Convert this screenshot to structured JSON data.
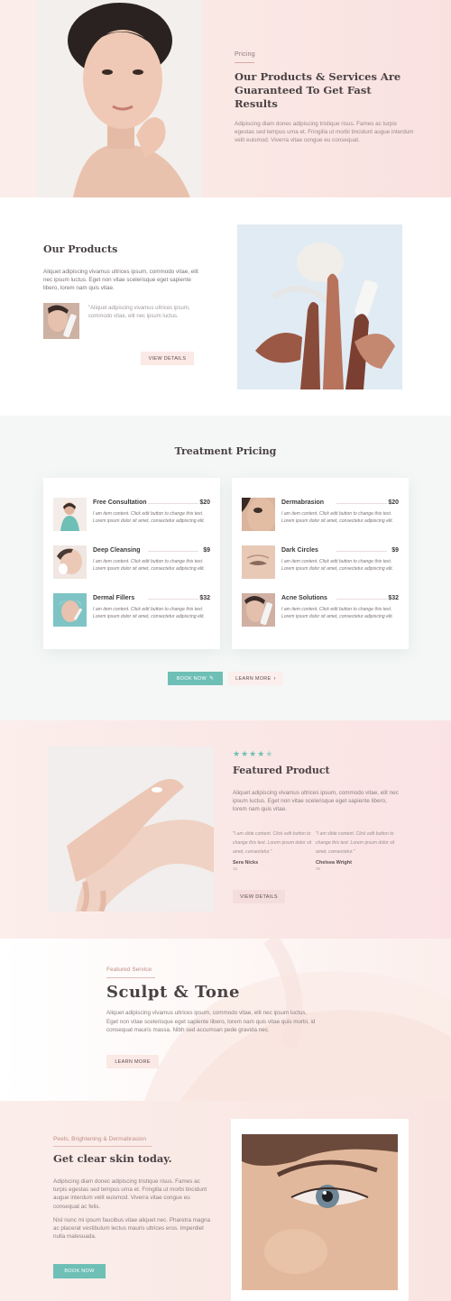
{
  "hero": {
    "eyebrow": "Pricing",
    "title": "Our Products & Services Are Guaranteed To Get Fast Results",
    "body": "Adipiscing diam donec adipiscing tristique risus. Fames ac turpis egestas sed tempus urna et. Fringilla ut morbi tincidunt augue interdum velit euismod. Viverra vitae congue eu consequat."
  },
  "products": {
    "title": "Our Products",
    "body": "Aliquet adipiscing vivamus ultrices ipsum, commodo vitae, elit nec ipsum luctus. Eget non vitae scelerisque eget sapiente libero, lorem nam quis vitae.",
    "quote": "\"Aliquet adipiscing vivamus ultrices ipsum, commodo vitae, elit nec ipsum luctus.",
    "button": "VIEW DETAILS"
  },
  "pricing": {
    "title": "Treatment Pricing",
    "left": [
      {
        "name": "Free Consultation",
        "price": "$20",
        "desc": "I am item content. Click edit button to change this text. Lorem ipsum dolor sit amet, consectetur adipiscing elit."
      },
      {
        "name": "Deep Cleansing",
        "price": "$9",
        "desc": "I am item content. Click edit button to change this text. Lorem ipsum dolor sit amet, consectetur adipiscing elit."
      },
      {
        "name": "Dermal Fillers",
        "price": "$32",
        "desc": "I am item content. Click edit button to change this text. Lorem ipsum dolor sit amet, consectetur adipiscing elit."
      }
    ],
    "right": [
      {
        "name": "Dermabrasion",
        "price": "$20",
        "desc": "I am item content. Click edit button to change this text. Lorem ipsum dolor sit amet, consectetur adipiscing elit."
      },
      {
        "name": "Dark Circles",
        "price": "$9",
        "desc": "I am item content. Click edit button to change this text. Lorem ipsum dolor sit amet, consectetur adipiscing elit."
      },
      {
        "name": "Acne Solutions",
        "price": "$32",
        "desc": "I am item content. Click edit button to change this text. Lorem ipsum dolor sit amet, consectetur adipiscing elit."
      }
    ],
    "book_button": "BOOK NOW",
    "learn_button": "LEARN MORE"
  },
  "featured": {
    "rating": 4.5,
    "title": "Featured Product",
    "body": "Aliquet adipiscing vivamus ultrices ipsum, commodo vitae, elit nec ipsum luctus. Eget non vitae scelerisque eget sapiente libero, lorem nam quis vitae.",
    "testimonials": [
      {
        "quote": "\"I am slide content. Click edit button to change this text. Lorem ipsum dolor sit amet, consectetur.\"",
        "name": "Sera Nicks",
        "role": "15"
      },
      {
        "quote": "\"I am slide content. Click edit button to change this text. Lorem ipsum dolor sit amet, consectetur.\"",
        "name": "Chelsea Wright",
        "role": "35"
      }
    ],
    "button": "VIEW DETAILS",
    "accent": "#6ebfb6"
  },
  "sculpt": {
    "eyebrow": "Featured Service",
    "title": "Sculpt & Tone",
    "body": "Aliquet adipiscing vivamus ultrices ipsum, commodo vitae, elit nec ipsum luctus. Eget non vitae scelerisque eget sapiente libero, lorem nam quis vitae quis morbi, id consequat mauris massa. Nibh sed accumsan pede gravida nec.",
    "button": "LEARN MORE"
  },
  "clear": {
    "eyebrow": "Peels, Brightening & Dermabrasion",
    "title": "Get clear skin today.",
    "body1": "Adipiscing diam donec adipiscing tristique risus. Fames ac turpis egestas sed tempus urna et. Fringilla ut morbi tincidunt augue interdum velit euismod. Viverra vitae congue eu consequat ac felis.",
    "body2": "Nisl nunc mi ipsum faucibus vitae aliquet nec. Pharetra magna ac placerat vestibulum lectus mauris ultrices eros. Imperdiet nulla malesuada.",
    "button": "BOOK NOW"
  },
  "colors": {
    "teal": "#6ebfb6",
    "blush": "#fbe9e6",
    "text": "#4a4244"
  }
}
